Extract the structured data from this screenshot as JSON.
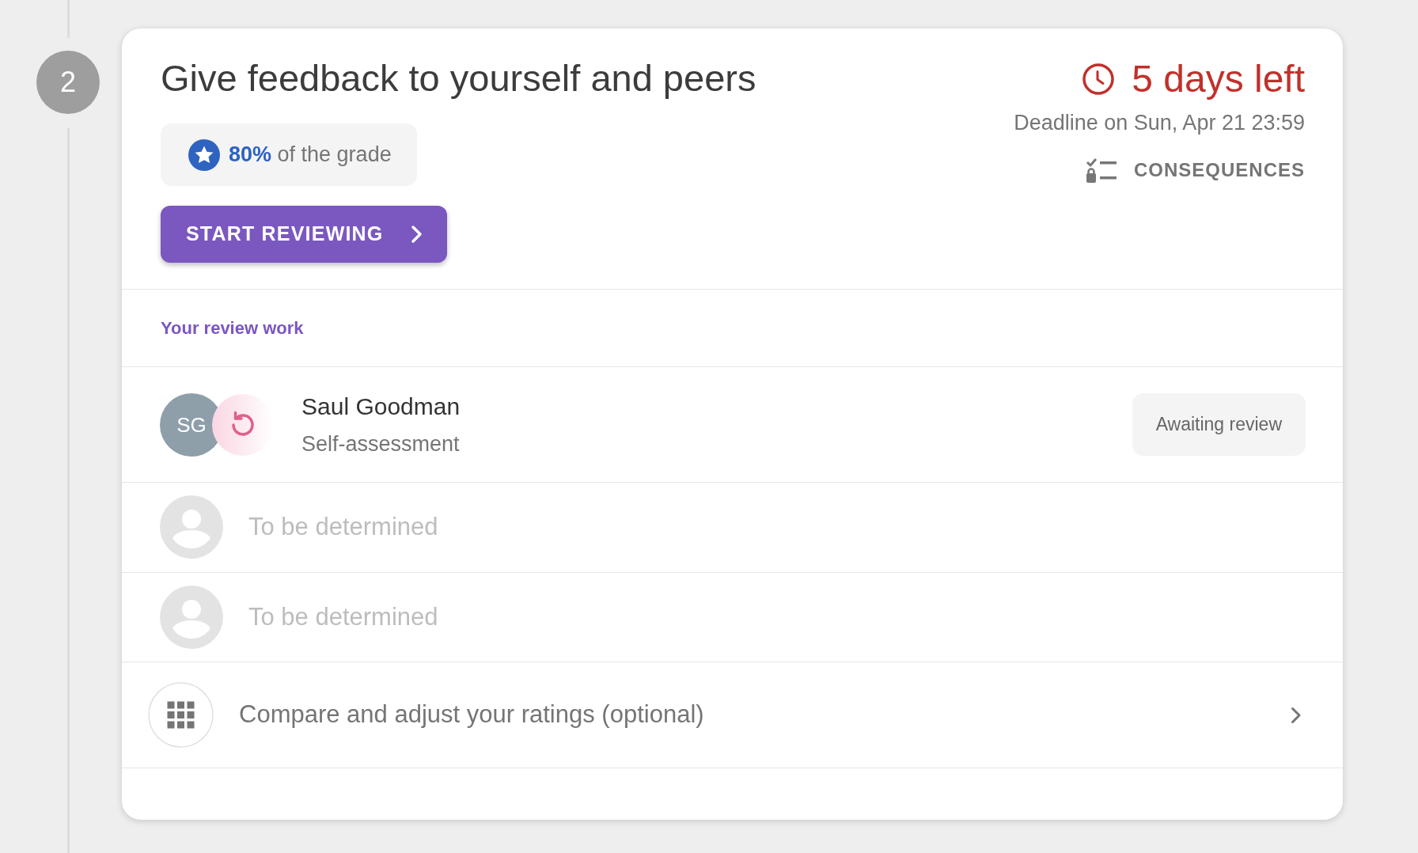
{
  "step": {
    "number": "2"
  },
  "task": {
    "title": "Give feedback to yourself and peers",
    "grade_weight": "**80%** of the grade",
    "start_button": "START REVIEWING",
    "time_left": "5 days left",
    "deadline": "Deadline on Sun, Apr 21 23:59",
    "consequences_button": "CONSEQUENCES"
  },
  "review_work": {
    "heading": "Your review work",
    "reviews": [
      {
        "kind": "assigned",
        "initials": "SG",
        "name": "Saul Goodman",
        "type": "Self-assessment",
        "status": "Awaiting review"
      },
      {
        "kind": "pending",
        "name": "To be determined"
      },
      {
        "kind": "pending",
        "name": "To be determined"
      }
    ],
    "compare_link": "Compare and adjust your ratings (optional)"
  }
}
